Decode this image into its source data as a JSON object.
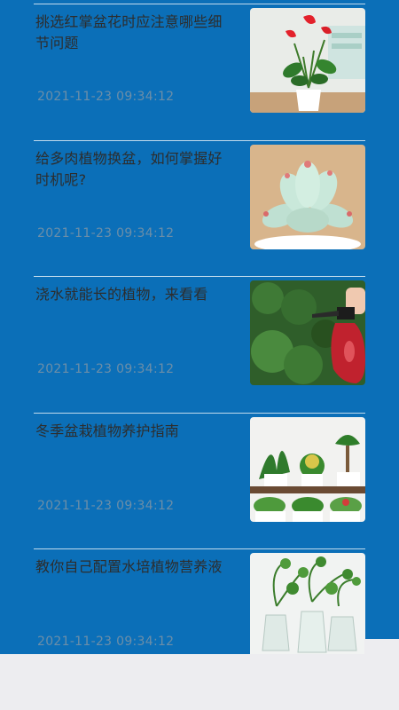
{
  "articles": [
    {
      "title": "挑选红掌盆花时应注意哪些细节问题",
      "time": "2021-11-23 09:34:12",
      "image_icon": "anthurium-plant"
    },
    {
      "title": "给多肉植物换盆，如何掌握好时机呢?",
      "time": "2021-11-23 09:34:12",
      "image_icon": "succulent-plant"
    },
    {
      "title": "浇水就能长的植物，来看看",
      "time": "2021-11-23 09:34:12",
      "image_icon": "watering-spray"
    },
    {
      "title": "冬季盆栽植物养护指南",
      "time": "2021-11-23 09:34:12",
      "image_icon": "potted-plants"
    },
    {
      "title": "教你自己配置水培植物营养液",
      "time": "2021-11-23 09:34:12",
      "image_icon": "hydroponic-plants"
    }
  ],
  "colors": {
    "background": "#0b6fb8",
    "title_text": "#2d2d2d",
    "time_text": "#6c8ea8",
    "bottom_bar": "#ededf0"
  }
}
